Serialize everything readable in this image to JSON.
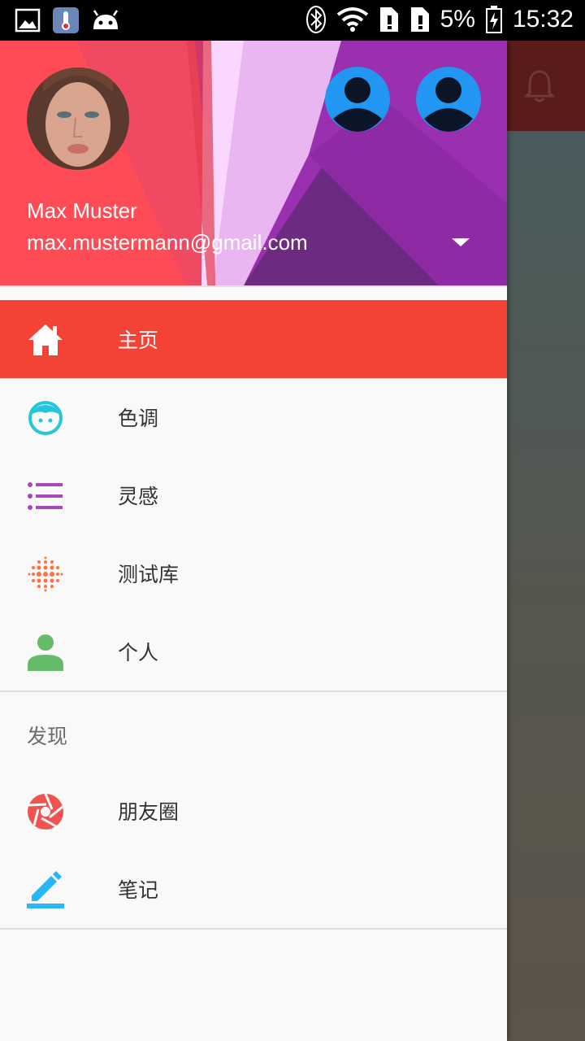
{
  "status_bar": {
    "battery_percent": "5%",
    "time": "15:32",
    "left_icons": [
      "image-icon",
      "thermometer-icon",
      "android-icon"
    ],
    "right_icons": [
      "bluetooth-icon",
      "wifi-icon",
      "sim-alert-icon",
      "sim-alert-icon",
      "battery-charging-icon"
    ]
  },
  "drawer": {
    "header": {
      "user_name": "Max Muster",
      "user_email": "max.mustermann@gmail.com",
      "colors": {
        "red": "#ff4b4b",
        "purple": "#9c27b0",
        "pink": "#f3c1f6"
      }
    },
    "items": [
      {
        "label": "主页",
        "icon": "home-icon",
        "active": true,
        "color": "#ffffff"
      },
      {
        "label": "色调",
        "icon": "face-icon",
        "active": false,
        "color": "#26c6da"
      },
      {
        "label": "灵感",
        "icon": "list-icon",
        "active": false,
        "color": "#ab47bc"
      },
      {
        "label": "测试库",
        "icon": "dots-grid-icon",
        "active": false,
        "color": "#ff7043"
      },
      {
        "label": "个人",
        "icon": "person-icon",
        "active": false,
        "color": "#66bb6a"
      }
    ],
    "section_title": "发现",
    "section_items": [
      {
        "label": "朋友圈",
        "icon": "camera-aperture-icon",
        "color": "#ef5350"
      },
      {
        "label": "笔记",
        "icon": "pencil-icon",
        "color": "#29b6f6"
      }
    ],
    "accent_color": "#f44336"
  },
  "background_app": {
    "toolbar_icon": "bell-icon"
  }
}
